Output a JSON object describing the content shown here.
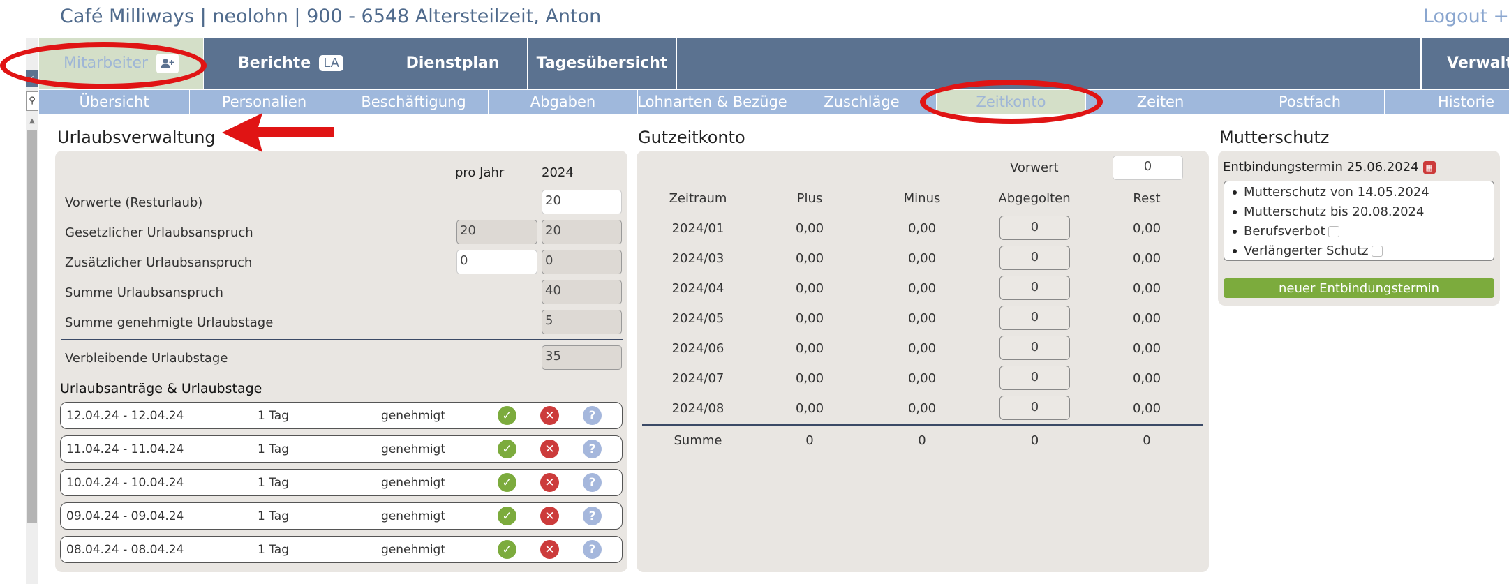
{
  "header": {
    "title": "Café Milliways | neolohn | 900 - 6548 Altersteilzeit, Anton",
    "logout_label": "Logout",
    "logout_icon": "plus-icon"
  },
  "main_tabs": [
    {
      "label": "Mitarbeiter",
      "icon": "add-user-icon",
      "active": true
    },
    {
      "label": "Berichte",
      "badge": "LA"
    },
    {
      "label": "Dienstplan"
    },
    {
      "label": "Tagesübersicht"
    },
    {
      "label": ""
    },
    {
      "label": "Verwaltung",
      "icon": "warning-icon"
    }
  ],
  "sub_tabs": [
    {
      "label": "Übersicht"
    },
    {
      "label": "Personalien"
    },
    {
      "label": "Beschäftigung"
    },
    {
      "label": "Abgaben"
    },
    {
      "label": "Lohnarten & Bezüge"
    },
    {
      "label": "Zuschläge"
    },
    {
      "label": "Zeitkonto",
      "active": true
    },
    {
      "label": "Zeiten"
    },
    {
      "label": "Postfach"
    },
    {
      "label": "Historie"
    }
  ],
  "urlaub": {
    "title": "Urlaubsverwaltung",
    "col_pro_jahr": "pro Jahr",
    "col_year": "2024",
    "rows": [
      {
        "label": "Vorwerte (Resturlaub)",
        "pro_jahr": null,
        "year": "20"
      },
      {
        "label": "Gesetzlicher Urlaubsanspruch",
        "pro_jahr": "20",
        "year": "20"
      },
      {
        "label": "Zusätzlicher Urlaubsanspruch",
        "pro_jahr": "0",
        "year": "0"
      },
      {
        "label": "Summe Urlaubsanspruch",
        "pro_jahr": null,
        "year": "40"
      },
      {
        "label": "Summe genehmigte Urlaubstage",
        "pro_jahr": null,
        "year": "5"
      }
    ],
    "remaining_label": "Verbleibende Urlaubstage",
    "remaining_value": "35",
    "requests_title": "Urlaubsanträge & Urlaubstage",
    "requests": [
      {
        "range": "12.04.24 - 12.04.24",
        "days": "1 Tag",
        "status": "genehmigt"
      },
      {
        "range": "11.04.24 - 11.04.24",
        "days": "1 Tag",
        "status": "genehmigt"
      },
      {
        "range": "10.04.24 - 10.04.24",
        "days": "1 Tag",
        "status": "genehmigt"
      },
      {
        "range": "09.04.24 - 09.04.24",
        "days": "1 Tag",
        "status": "genehmigt"
      },
      {
        "range": "08.04.24 - 08.04.24",
        "days": "1 Tag",
        "status": "genehmigt"
      }
    ]
  },
  "gutzeit": {
    "title": "Gutzeitkonto",
    "vorwert_label": "Vorwert",
    "vorwert_value": "0",
    "columns": [
      "Zeitraum",
      "Plus",
      "Minus",
      "Abgegolten",
      "Rest"
    ],
    "rows": [
      {
        "period": "2024/01",
        "plus": "0,00",
        "minus": "0,00",
        "abgegolten": "0",
        "rest": "0,00"
      },
      {
        "period": "2024/03",
        "plus": "0,00",
        "minus": "0,00",
        "abgegolten": "0",
        "rest": "0,00"
      },
      {
        "period": "2024/04",
        "plus": "0,00",
        "minus": "0,00",
        "abgegolten": "0",
        "rest": "0,00"
      },
      {
        "period": "2024/05",
        "plus": "0,00",
        "minus": "0,00",
        "abgegolten": "0",
        "rest": "0,00"
      },
      {
        "period": "2024/06",
        "plus": "0,00",
        "minus": "0,00",
        "abgegolten": "0",
        "rest": "0,00"
      },
      {
        "period": "2024/07",
        "plus": "0,00",
        "minus": "0,00",
        "abgegolten": "0",
        "rest": "0,00"
      },
      {
        "period": "2024/08",
        "plus": "0,00",
        "minus": "0,00",
        "abgegolten": "0",
        "rest": "0,00"
      }
    ],
    "sum": {
      "label": "Summe",
      "plus": "0",
      "minus": "0",
      "abgegolten": "0",
      "rest": "0"
    }
  },
  "mutterschutz": {
    "title": "Mutterschutz",
    "termin_label": "Entbindungstermin 25.06.2024",
    "items": [
      "Mutterschutz von 14.05.2024",
      "Mutterschutz bis 20.08.2024",
      "Berufsverbot",
      "Verlängerter Schutz"
    ],
    "new_button": "neuer Entbindungstermin"
  },
  "colors": {
    "nav": "#5b7290",
    "subnav": "#9fb8dc",
    "active_tab": "#d4dfc8",
    "approve": "#7cab3d",
    "reject": "#cc3b3b",
    "question": "#a5b7dc",
    "annotation": "#e01414"
  }
}
